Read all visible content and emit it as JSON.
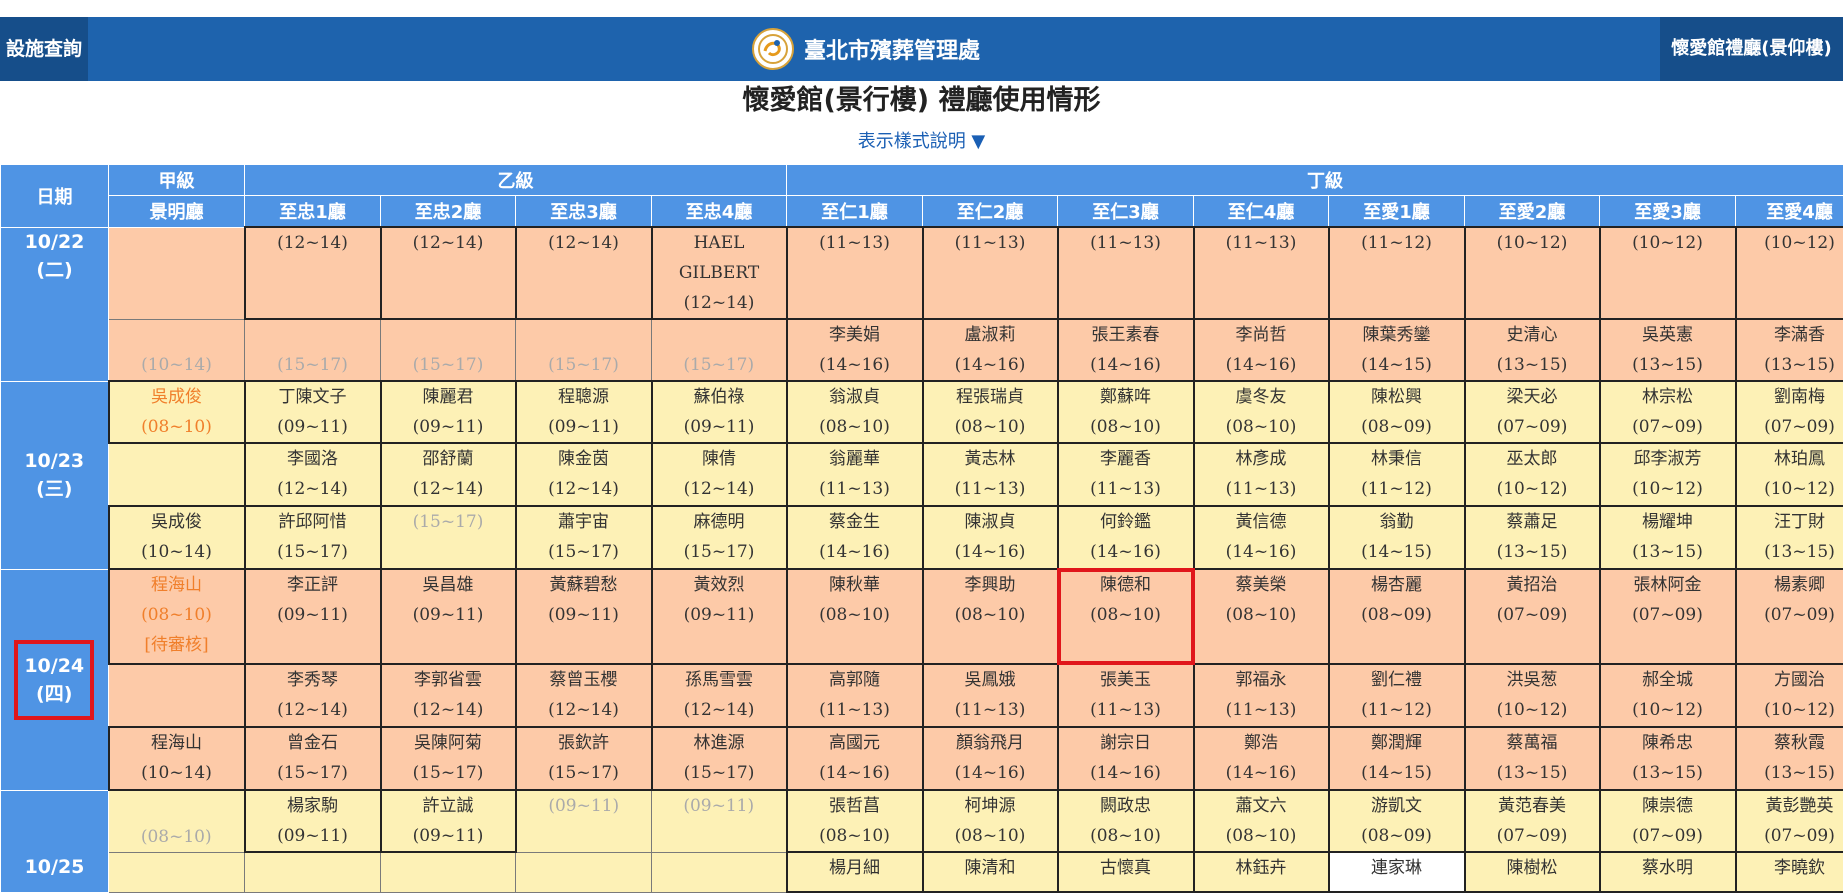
{
  "header": {
    "left_tab": "設施查詢",
    "title": "臺北市殯葬管理處",
    "right_tab": "懷愛館禮廳(景仰樓)"
  },
  "page_title": "懷愛館(景行樓) 禮廳使用情形",
  "legend_link": "表示樣式說明 ▼",
  "table": {
    "date_header": "日期",
    "grades": [
      "甲級",
      "乙級",
      "丁級"
    ],
    "halls": [
      "景明廳",
      "至忠1廳",
      "至忠2廳",
      "至忠3廳",
      "至忠4廳",
      "至仁1廳",
      "至仁2廳",
      "至仁3廳",
      "至仁4廳",
      "至愛1廳",
      "至愛2廳",
      "至愛3廳",
      "至愛4廳"
    ],
    "dates": [
      {
        "date": "10/22",
        "weekday": "(二)"
      },
      {
        "date": "10/23",
        "weekday": "(三)"
      },
      {
        "date": "10/24",
        "weekday": "(四)"
      },
      {
        "date": "10/25",
        "weekday": ""
      }
    ],
    "rows": [
      [
        {
          "n": "",
          "t": ""
        },
        {
          "n": "",
          "t": "(12~14)"
        },
        {
          "n": "",
          "t": "(12~14)"
        },
        {
          "n": "",
          "t": "(12~14)"
        },
        {
          "n": "HAEL GILBERT",
          "t": "(12~14)"
        },
        {
          "n": "",
          "t": "(11~13)"
        },
        {
          "n": "",
          "t": "(11~13)"
        },
        {
          "n": "",
          "t": "(11~13)"
        },
        {
          "n": "",
          "t": "(11~13)"
        },
        {
          "n": "",
          "t": "(11~12)"
        },
        {
          "n": "",
          "t": "(10~12)"
        },
        {
          "n": "",
          "t": "(10~12)"
        },
        {
          "n": "",
          "t": "(10~12)"
        }
      ],
      [
        {
          "n": "",
          "t": "(10~14)"
        },
        {
          "n": "",
          "t": "(15~17)"
        },
        {
          "n": "",
          "t": "(15~17)"
        },
        {
          "n": "",
          "t": "(15~17)"
        },
        {
          "n": "",
          "t": "(15~17)"
        },
        {
          "n": "李美娟",
          "t": "(14~16)"
        },
        {
          "n": "盧淑莉",
          "t": "(14~16)"
        },
        {
          "n": "張王素春",
          "t": "(14~16)"
        },
        {
          "n": "李尚哲",
          "t": "(14~16)"
        },
        {
          "n": "陳葉秀鑾",
          "t": "(14~15)"
        },
        {
          "n": "史清心",
          "t": "(13~15)"
        },
        {
          "n": "吳英憲",
          "t": "(13~15)"
        },
        {
          "n": "李滿香",
          "t": "(13~15)"
        }
      ],
      [
        {
          "n": "吳成俊",
          "t": "(08~10)"
        },
        {
          "n": "丁陳文子",
          "t": "(09~11)"
        },
        {
          "n": "陳麗君",
          "t": "(09~11)"
        },
        {
          "n": "程聰源",
          "t": "(09~11)"
        },
        {
          "n": "蘇伯祿",
          "t": "(09~11)"
        },
        {
          "n": "翁淑貞",
          "t": "(08~10)"
        },
        {
          "n": "程張瑞貞",
          "t": "(08~10)"
        },
        {
          "n": "鄭蘇哖",
          "t": "(08~10)"
        },
        {
          "n": "虞冬友",
          "t": "(08~10)"
        },
        {
          "n": "陳松興",
          "t": "(08~09)"
        },
        {
          "n": "梁天必",
          "t": "(07~09)"
        },
        {
          "n": "林宗松",
          "t": "(07~09)"
        },
        {
          "n": "劉南梅",
          "t": "(07~09)"
        }
      ],
      [
        {
          "n": "",
          "t": ""
        },
        {
          "n": "李國洛",
          "t": "(12~14)"
        },
        {
          "n": "邵舒蘭",
          "t": "(12~14)"
        },
        {
          "n": "陳金茵",
          "t": "(12~14)"
        },
        {
          "n": "陳倩",
          "t": "(12~14)"
        },
        {
          "n": "翁麗華",
          "t": "(11~13)"
        },
        {
          "n": "黃志林",
          "t": "(11~13)"
        },
        {
          "n": "李麗香",
          "t": "(11~13)"
        },
        {
          "n": "林彥成",
          "t": "(11~13)"
        },
        {
          "n": "林秉信",
          "t": "(11~12)"
        },
        {
          "n": "巫太郎",
          "t": "(10~12)"
        },
        {
          "n": "邱李淑芳",
          "t": "(10~12)"
        },
        {
          "n": "林珀鳳",
          "t": "(10~12)"
        }
      ],
      [
        {
          "n": "吳成俊",
          "t": "(10~14)"
        },
        {
          "n": "許邱阿惜",
          "t": "(15~17)"
        },
        {
          "n": "",
          "t": "(15~17)"
        },
        {
          "n": "蕭宇宙",
          "t": "(15~17)"
        },
        {
          "n": "麻德明",
          "t": "(15~17)"
        },
        {
          "n": "蔡金生",
          "t": "(14~16)"
        },
        {
          "n": "陳淑貞",
          "t": "(14~16)"
        },
        {
          "n": "何鈴鑑",
          "t": "(14~16)"
        },
        {
          "n": "黃信德",
          "t": "(14~16)"
        },
        {
          "n": "翁勤",
          "t": "(14~15)"
        },
        {
          "n": "蔡蕭足",
          "t": "(13~15)"
        },
        {
          "n": "楊耀坤",
          "t": "(13~15)"
        },
        {
          "n": "汪丁財",
          "t": "(13~15)"
        }
      ],
      [
        {
          "n": "程海山",
          "t": "(08~10)",
          "x": "[待審核]"
        },
        {
          "n": "李正評",
          "t": "(09~11)"
        },
        {
          "n": "吳昌雄",
          "t": "(09~11)"
        },
        {
          "n": "黃蘇碧愁",
          "t": "(09~11)"
        },
        {
          "n": "黃效烈",
          "t": "(09~11)"
        },
        {
          "n": "陳秋華",
          "t": "(08~10)"
        },
        {
          "n": "李興助",
          "t": "(08~10)"
        },
        {
          "n": "陳德和",
          "t": "(08~10)"
        },
        {
          "n": "蔡美榮",
          "t": "(08~10)"
        },
        {
          "n": "楊杏麗",
          "t": "(08~09)"
        },
        {
          "n": "黃招治",
          "t": "(07~09)"
        },
        {
          "n": "張林阿金",
          "t": "(07~09)"
        },
        {
          "n": "楊素卿",
          "t": "(07~09)"
        }
      ],
      [
        {
          "n": "",
          "t": ""
        },
        {
          "n": "李秀琴",
          "t": "(12~14)"
        },
        {
          "n": "李郭省雲",
          "t": "(12~14)"
        },
        {
          "n": "蔡曾玉櫻",
          "t": "(12~14)"
        },
        {
          "n": "孫馬雪雲",
          "t": "(12~14)"
        },
        {
          "n": "高郭隨",
          "t": "(11~13)"
        },
        {
          "n": "吳鳳娥",
          "t": "(11~13)"
        },
        {
          "n": "張美玉",
          "t": "(11~13)"
        },
        {
          "n": "郭福永",
          "t": "(11~13)"
        },
        {
          "n": "劉仁禮",
          "t": "(11~12)"
        },
        {
          "n": "洪吳葱",
          "t": "(10~12)"
        },
        {
          "n": "郝全城",
          "t": "(10~12)"
        },
        {
          "n": "方國治",
          "t": "(10~12)"
        }
      ],
      [
        {
          "n": "程海山",
          "t": "(10~14)"
        },
        {
          "n": "曾金石",
          "t": "(15~17)"
        },
        {
          "n": "吳陳阿菊",
          "t": "(15~17)"
        },
        {
          "n": "張欽許",
          "t": "(15~17)"
        },
        {
          "n": "林進源",
          "t": "(15~17)"
        },
        {
          "n": "高國元",
          "t": "(14~16)"
        },
        {
          "n": "顏翁飛月",
          "t": "(14~16)"
        },
        {
          "n": "謝宗日",
          "t": "(14~16)"
        },
        {
          "n": "鄭浩",
          "t": "(14~16)"
        },
        {
          "n": "鄭潤輝",
          "t": "(14~15)"
        },
        {
          "n": "蔡萬福",
          "t": "(13~15)"
        },
        {
          "n": "陳希忠",
          "t": "(13~15)"
        },
        {
          "n": "蔡秋霞",
          "t": "(13~15)"
        }
      ],
      [
        {
          "n": "",
          "t": "(08~10)"
        },
        {
          "n": "楊家駒",
          "t": "(09~11)"
        },
        {
          "n": "許立誠",
          "t": "(09~11)"
        },
        {
          "n": "",
          "t": "(09~11)"
        },
        {
          "n": "",
          "t": "(09~11)"
        },
        {
          "n": "張哲菖",
          "t": "(08~10)"
        },
        {
          "n": "柯坤源",
          "t": "(08~10)"
        },
        {
          "n": "闕政忠",
          "t": "(08~10)"
        },
        {
          "n": "蕭文六",
          "t": "(08~10)"
        },
        {
          "n": "游凱文",
          "t": "(08~09)"
        },
        {
          "n": "黃范春美",
          "t": "(07~09)"
        },
        {
          "n": "陳崇德",
          "t": "(07~09)"
        },
        {
          "n": "黃彭艷英",
          "t": "(07~09)"
        }
      ],
      [
        {
          "n": "",
          "t": ""
        },
        {
          "n": "",
          "t": ""
        },
        {
          "n": "",
          "t": ""
        },
        {
          "n": "",
          "t": ""
        },
        {
          "n": "",
          "t": ""
        },
        {
          "n": "楊月細",
          "t": ""
        },
        {
          "n": "陳清和",
          "t": ""
        },
        {
          "n": "古懷真",
          "t": ""
        },
        {
          "n": "林鈺卉",
          "t": ""
        },
        {
          "n": "連家琳",
          "t": ""
        },
        {
          "n": "陳樹松",
          "t": ""
        },
        {
          "n": "蔡水明",
          "t": ""
        },
        {
          "n": "李曉欽",
          "t": ""
        }
      ]
    ]
  },
  "colors": {
    "header_blue": "#1e63ad",
    "header_dark": "#164e8a",
    "table_header_blue": "#4f94e4",
    "peach": "#fdcaa8",
    "cream": "#fdf1b6",
    "pending_orange": "#f07f2b",
    "highlight_red": "#e0161b"
  }
}
